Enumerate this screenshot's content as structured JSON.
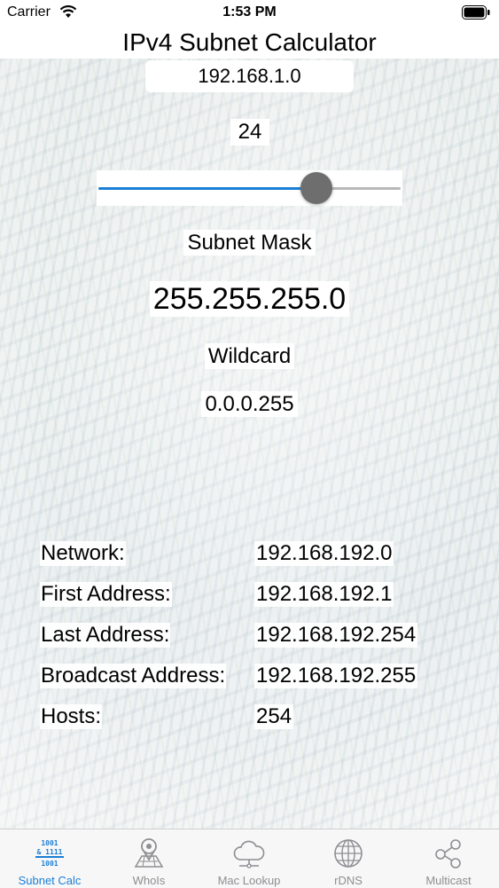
{
  "status_bar": {
    "carrier": "Carrier",
    "time": "1:53 PM"
  },
  "app": {
    "title": "IPv4 Subnet Calculator"
  },
  "input": {
    "ip_value": "192.168.1.0"
  },
  "cidr": {
    "value": "24",
    "slider_fraction": 0.72
  },
  "subnet_mask": {
    "label": "Subnet Mask",
    "value": "255.255.255.0"
  },
  "wildcard": {
    "label": "Wildcard",
    "value": "0.0.0.255"
  },
  "results": [
    {
      "label": "Network:",
      "value": "192.168.192.0"
    },
    {
      "label": "First Address:",
      "value": "192.168.192.1"
    },
    {
      "label": "Last Address:",
      "value": "192.168.192.254"
    },
    {
      "label": "Broadcast Address:",
      "value": "192.168.192.255"
    },
    {
      "label": "Hosts:",
      "value": "254"
    }
  ],
  "tabs": [
    {
      "label": "Subnet Calc",
      "icon": "binary-icon",
      "active": true
    },
    {
      "label": "WhoIs",
      "icon": "map-pin-icon",
      "active": false
    },
    {
      "label": "Mac Lookup",
      "icon": "cloud-icon",
      "active": false
    },
    {
      "label": "rDNS",
      "icon": "globe-icon",
      "active": false
    },
    {
      "label": "Multicast",
      "icon": "share-icon",
      "active": false
    }
  ],
  "colors": {
    "accent": "#1a7fd6",
    "inactive_tab": "#8e8e93",
    "slider_thumb": "#6e6e6e"
  }
}
